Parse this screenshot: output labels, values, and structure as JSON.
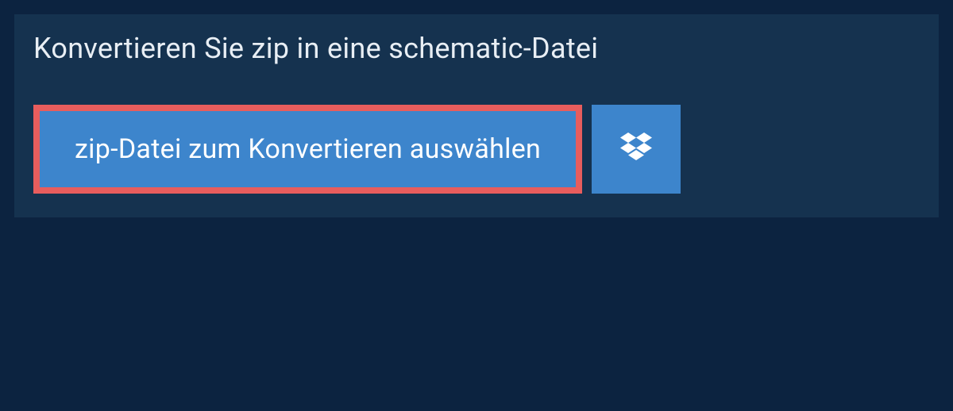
{
  "header": {
    "title": "Konvertieren Sie zip in eine schematic-Datei"
  },
  "actions": {
    "select_label": "zip-Datei zum Konvertieren auswählen"
  },
  "colors": {
    "page_bg": "#0c2340",
    "panel_bg": "#15324f",
    "button_bg": "#3d85cc",
    "button_border": "#e85d5d",
    "text_light": "#e8eef4"
  }
}
